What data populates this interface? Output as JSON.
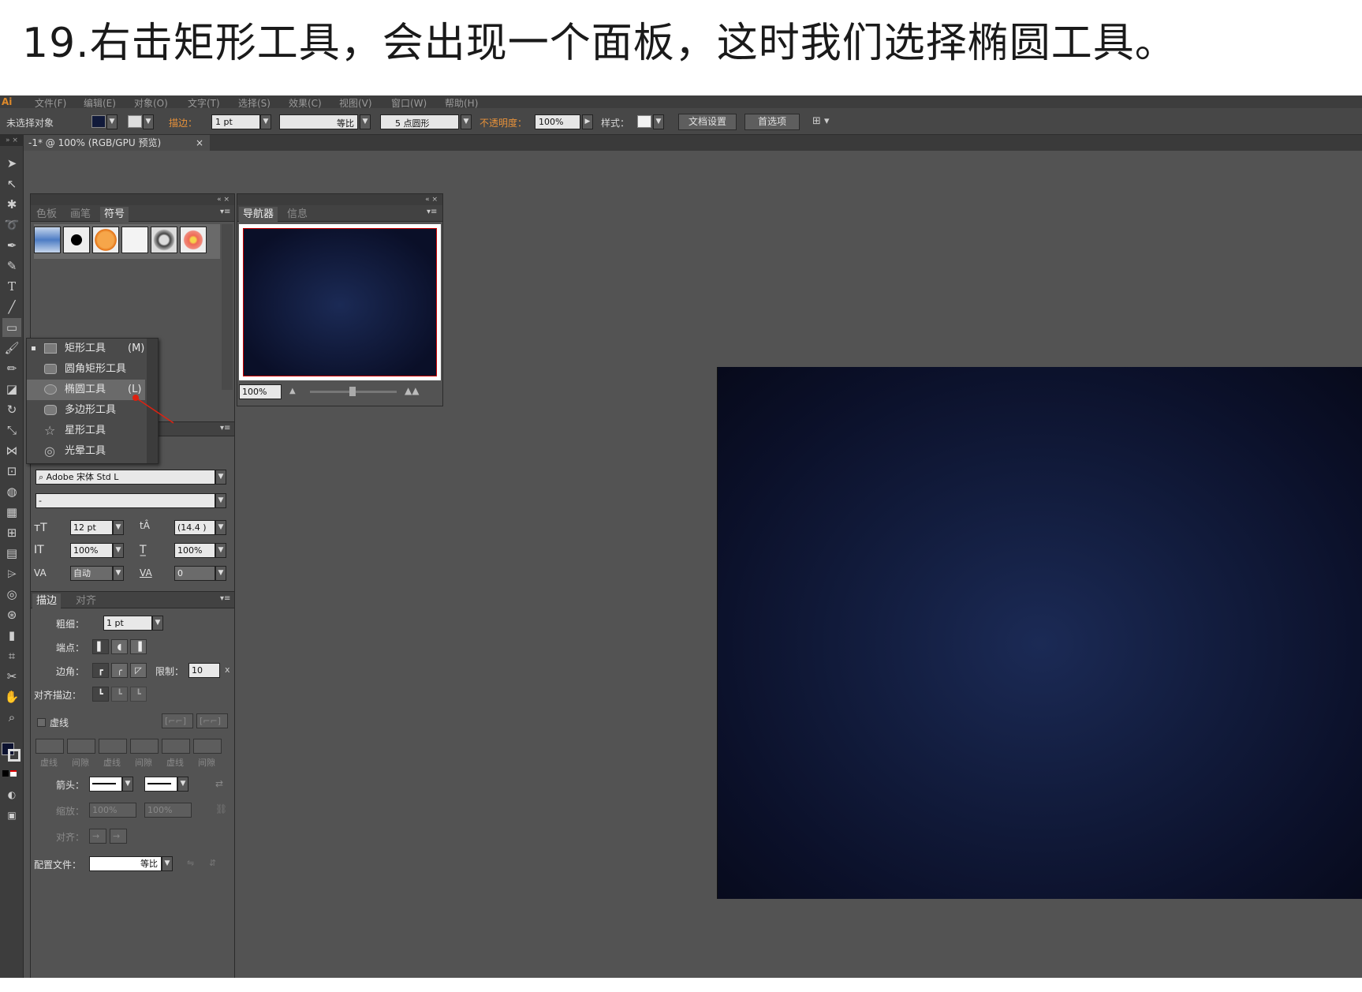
{
  "caption": "19.右击矩形工具，会出现一个面板，这时我们选择椭圆工具。",
  "menu": [
    "Ai",
    "文件(F)",
    "编辑(E)",
    "对象(O)",
    "文字(T)",
    "选择(S)",
    "效果(C)",
    "视图(V)",
    "窗口(W)",
    "帮助(H)"
  ],
  "control_bar": {
    "selection": "未选择对象",
    "stroke_label": "描边：",
    "stroke_value": "1 pt",
    "profile_label": "等比",
    "brush_label": "5 点圆形",
    "opacity_label": "不透明度：",
    "opacity_value": "100%",
    "style_label": "样式：",
    "doc_setup": "文档设置",
    "preferences": "首选项"
  },
  "doc_tab": {
    "title": "-1* @ 100% (RGB/GPU 预览)",
    "close": "×"
  },
  "symbols_panel": {
    "tabs": [
      "色板",
      "画笔",
      "符号"
    ],
    "active": 2
  },
  "navigator_panel": {
    "tabs": [
      "导航器",
      "信息"
    ],
    "active": 0,
    "zoom": "100%"
  },
  "flyout": {
    "items": [
      {
        "label": "矩形工具",
        "key": "(M)"
      },
      {
        "label": "圆角矩形工具",
        "key": ""
      },
      {
        "label": "椭圆工具",
        "key": "(L)"
      },
      {
        "label": "多边形工具",
        "key": ""
      },
      {
        "label": "星形工具",
        "key": ""
      },
      {
        "label": "光晕工具",
        "key": ""
      }
    ],
    "selected_index": 2
  },
  "character_panel": {
    "font": "Adobe 宋体 Std L",
    "style": "-",
    "size": "12 pt",
    "leading": "(14.4 )",
    "vscale": "100%",
    "hscale": "100%",
    "kerning": "自动",
    "tracking": "0"
  },
  "stroke_panel": {
    "tabs": [
      "描边",
      "对齐"
    ],
    "weight_label": "粗细：",
    "weight_value": "1 pt",
    "cap_label": "端点：",
    "corner_label": "边角：",
    "limit_label": "限制：",
    "limit_value": "10",
    "align_label": "对齐描边：",
    "dashed_label": "虚线",
    "dash_cols": [
      "虚线",
      "间隙",
      "虚线",
      "间隙",
      "虚线",
      "间隙"
    ],
    "arrow_label": "箭头：",
    "scale_label": "缩放：",
    "scale_a": "100%",
    "scale_b": "100%",
    "align2_label": "对齐：",
    "profile_label": "配置文件：",
    "profile_value": "等比"
  }
}
